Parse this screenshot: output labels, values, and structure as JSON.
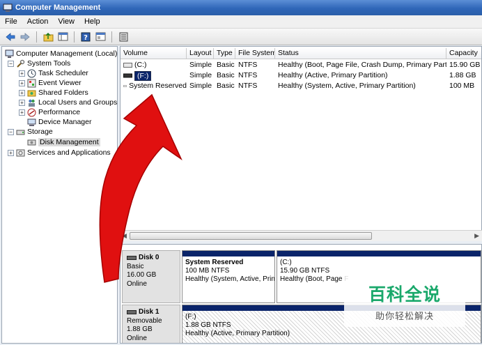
{
  "window": {
    "title": "Computer Management"
  },
  "menu": {
    "items": [
      "File",
      "Action",
      "View",
      "Help"
    ]
  },
  "tree": {
    "root": "Computer Management (Local)",
    "system_tools": "System Tools",
    "task_scheduler": "Task Scheduler",
    "event_viewer": "Event Viewer",
    "shared_folders": "Shared Folders",
    "local_users": "Local Users and Groups",
    "performance": "Performance",
    "device_manager": "Device Manager",
    "storage": "Storage",
    "disk_management": "Disk Management",
    "services": "Services and Applications"
  },
  "volumes": {
    "columns": [
      "Volume",
      "Layout",
      "Type",
      "File System",
      "Status",
      "Capacity"
    ],
    "rows": [
      {
        "volume": "(C:)",
        "layout": "Simple",
        "type": "Basic",
        "fs": "NTFS",
        "status": "Healthy (Boot, Page File, Crash Dump, Primary Partition)",
        "capacity": "15.90 GB"
      },
      {
        "volume": "(F:)",
        "layout": "Simple",
        "type": "Basic",
        "fs": "NTFS",
        "status": "Healthy (Active, Primary Partition)",
        "capacity": "1.88 GB"
      },
      {
        "volume": "System Reserved",
        "layout": "Simple",
        "type": "Basic",
        "fs": "NTFS",
        "status": "Healthy (System, Active, Primary Partition)",
        "capacity": "100 MB"
      }
    ]
  },
  "disks": {
    "disk0": {
      "name": "Disk 0",
      "kind": "Basic",
      "size": "16.00 GB",
      "state": "Online",
      "part1": {
        "title": "System Reserved",
        "size": "100 MB NTFS",
        "status": "Healthy (System, Active, Prin"
      },
      "part2": {
        "title": "(C:)",
        "size": "15.90 GB NTFS",
        "status": "Healthy (Boot, Page F"
      }
    },
    "disk1": {
      "name": "Disk 1",
      "kind": "Removable",
      "size": "1.88 GB",
      "state": "Online",
      "part1": {
        "title": "(F:)",
        "size": "1.88 GB NTFS",
        "status": "Healthy (Active, Primary Partition)"
      }
    }
  },
  "watermark": {
    "title": "百科全说",
    "subtitle": "助你轻松解决"
  },
  "colors": {
    "titlebar": "#2f66b8",
    "partition_stripe": "#0a246a",
    "arrow": "#e01010",
    "watermark": "#1aa86b"
  }
}
